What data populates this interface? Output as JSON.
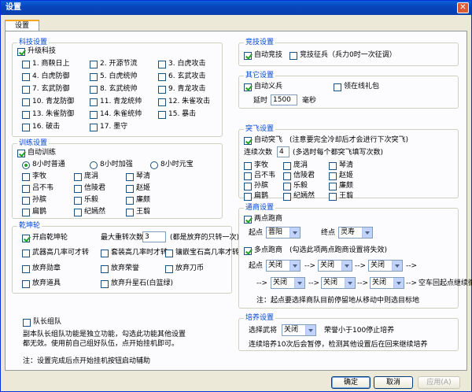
{
  "window": {
    "title": "设置",
    "close": "✕"
  },
  "tab": "设置",
  "keji": {
    "title": "科技设置",
    "upgrade": "升级科技",
    "items": [
      "1. 商鞅日上",
      "2. 开源节流",
      "3. 白虎攻击",
      "4. 白虎防御",
      "5. 白虎统帅",
      "6. 玄武攻击",
      "7. 玄武防御",
      "8. 玄武统帅",
      "9. 青龙攻击",
      "10. 青龙防御",
      "11. 青龙统帅",
      "12. 朱雀攻击",
      "13. 朱雀防御",
      "14. 朱雀统帅",
      "15. 暴击",
      "16. 破击",
      "17. 墨守"
    ]
  },
  "xunlian": {
    "title": "训练设置",
    "auto": "自动训练",
    "modes": [
      "8小时普通",
      "8小时加强",
      "8小时元宝"
    ],
    "generals": [
      "李牧",
      "庞涓",
      "琴清",
      "吕不韦",
      "信陵君",
      "赵姬",
      "孙膑",
      "乐毅",
      "廉颇",
      "扁鹊",
      "纪嫣然",
      "王翦"
    ]
  },
  "qiankun": {
    "title": "乾坤轮",
    "enable": "开启乾坤轮",
    "max_label": "最大重转次数",
    "max_value": "3",
    "max_note": "(都是放弃的只转一次)",
    "opts": [
      "武器高几率可才转",
      "套装高几率时才转",
      "镶嵌宝石高几率才转",
      "放弃勋章",
      "放弃荣誉",
      "放弃刀币",
      "放弃道具",
      "放弃升星石(白篮绿)"
    ]
  },
  "team": {
    "label": "队长组队",
    "desc1": "副本队长组队功能是独立功能，勾选此功能其他设置",
    "desc2": "都无效。使用前自己组好队伍，点开始挂机即可。"
  },
  "footnote": "注：设置完成后点开始挂机按钮启动辅助",
  "jingji": {
    "title": "竞技设置",
    "auto": "自动竞技",
    "zhengbing": "竞技征兵（兵力0时一次征调）"
  },
  "qita": {
    "title": "其它设置",
    "auto_yibing": "自动义兵",
    "lingqu": "领在线礼包",
    "delay_label": "延时",
    "delay_value": "1500",
    "delay_unit": "毫秒"
  },
  "tufei": {
    "title": "突飞设置",
    "auto": "自动突飞",
    "note": "(注意要完全冷却后才会进行下次突飞)",
    "count_label": "连续次数",
    "count_value": "4",
    "count_note": "(多选时每个都突飞填写次数)",
    "generals": [
      "李牧",
      "庞涓",
      "琴清",
      "吕不韦",
      "信陵君",
      "赵姬",
      "孙膑",
      "乐毅",
      "廉颇",
      "扁鹊",
      "纪嫣然",
      "王翦"
    ]
  },
  "tongshang": {
    "title": "通商设置",
    "two_point": "两点跑商",
    "start_label": "起点",
    "start_value": "晋阳",
    "end_label": "终点",
    "end_value": "灵寿",
    "multi": "多点跑商",
    "multi_note": "(勾选此项两点跑商设置将失效)",
    "off": "关闭",
    "arrow": "-->",
    "loop_note": "空车回起点继续循环",
    "note": "注：起点要选择商队目前停留地从移动中则选目标地"
  },
  "peiyang": {
    "title": "培养设置",
    "select_label": "选择武将",
    "select_value": "关闭",
    "honor_note": "荣誉小于100停止培养",
    "desc": "连续培养10次后会暂停，检测其他设置后在回来继续培养"
  },
  "buttons": {
    "ok": "确定",
    "cancel": "取消",
    "apply": "应用(A)"
  }
}
